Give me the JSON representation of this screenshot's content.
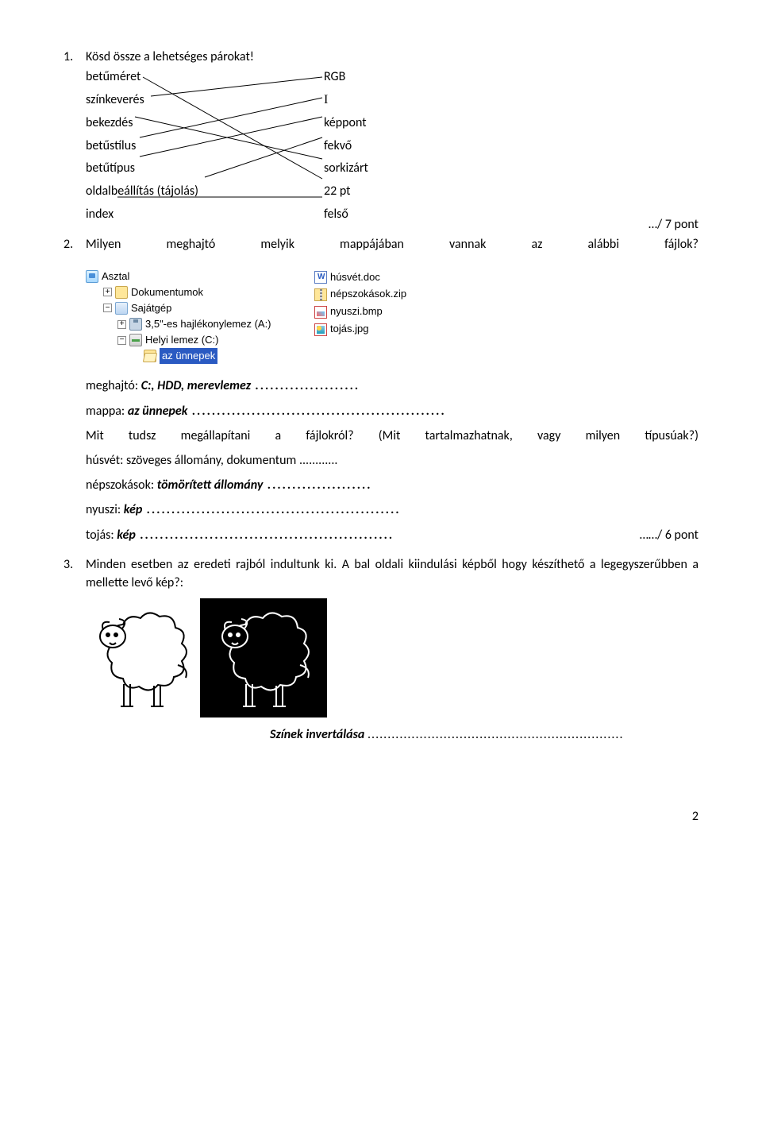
{
  "q1": {
    "num": "1.",
    "title": "Kösd össze a lehetséges párokat!",
    "left": [
      "betűméret",
      "színkeverés",
      "bekezdés",
      "betűstílus",
      "betűtípus",
      "oldalbeállítás (tájolás)",
      "index"
    ],
    "right": [
      "RGB",
      "I",
      "képpont",
      "fekvő",
      "sorkizárt",
      "22 pt",
      "felső"
    ],
    "score": "…/ 7 pont"
  },
  "q2": {
    "num": "2.",
    "words": [
      "Milyen",
      "meghajtó",
      "melyik",
      "mappájában",
      "vannak",
      "az",
      "alábbi",
      "fájlok?"
    ]
  },
  "tree": {
    "root": "Asztal",
    "docs": "Dokumentumok",
    "computer": "Sajátgép",
    "floppy": "3,5\"-es hajlékonylemez (A:)",
    "drive": "Helyi lemez (C:)",
    "selected": "az ünnepek"
  },
  "files": {
    "doc": "húsvét.doc",
    "zip": "népszokások.zip",
    "bmp": "nyuszi.bmp",
    "jpg": "tojás.jpg"
  },
  "answers": {
    "drive_label": "meghajtó:  ",
    "drive_val": "C:, HDD, merevlemez",
    "folder_label": "mappa:  ",
    "folder_val": "az ünnepek",
    "mit_words": [
      "Mit",
      "tudsz",
      "megállapítani",
      "a",
      "fájlokról?",
      "(Mit",
      "tartalmazhatnak,",
      "vagy",
      "milyen",
      "típusúak?)"
    ],
    "husvet_label": "húsvét: ",
    "husvet_val": "szöveges állomány, dokumentum",
    "nepsz_label": "népszokások:  ",
    "nepsz_val": "tömörített állomány",
    "nyuszi_label": "nyuszi: ",
    "nyuszi_val": "kép",
    "tojas_label": "tojás:  ",
    "tojas_val": "kép",
    "score": "……/ 6 pont"
  },
  "q3": {
    "num": "3.",
    "text": "Minden esetben az eredeti rajból indultunk ki. A bal oldali kiindulási képből hogy készíthető a legegyszerűbben a mellette levő kép?:"
  },
  "invert": {
    "val": "Színek invertálása"
  },
  "page_num": "2"
}
